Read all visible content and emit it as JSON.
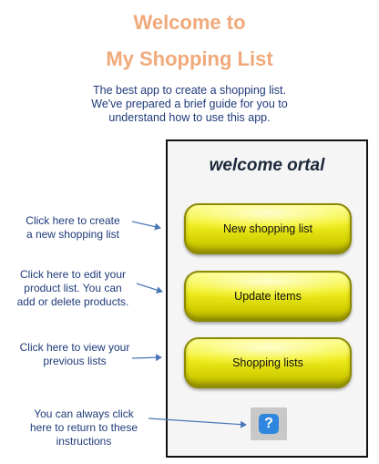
{
  "header": {
    "title_line1": "Welcome to",
    "title_line2": "My Shopping List",
    "intro_lines": [
      "The best app to create a shopping list.",
      "We've prepared a brief guide for you to",
      "understand how to use this app."
    ]
  },
  "phone": {
    "welcome_text": "welcome ortal",
    "buttons": {
      "new_list": "New shopping list",
      "update_items": "Update items",
      "shopping_lists": "Shopping lists"
    },
    "help_icon": "question-mark-icon"
  },
  "annotations": {
    "new_list": [
      "Click here to create",
      "a new shopping list"
    ],
    "update_items": [
      "Click here to edit your",
      "product list. You can",
      "add or delete products."
    ],
    "shopping_lists": [
      "Click here to view your",
      "previous lists"
    ],
    "help": [
      "You can always click",
      "here to return to these",
      "instructions"
    ]
  },
  "colors": {
    "title": "#f0a97a",
    "annotation_text": "#1f3a7a",
    "button_yellow": "#f0ee20",
    "help_blue": "#2e86de"
  }
}
